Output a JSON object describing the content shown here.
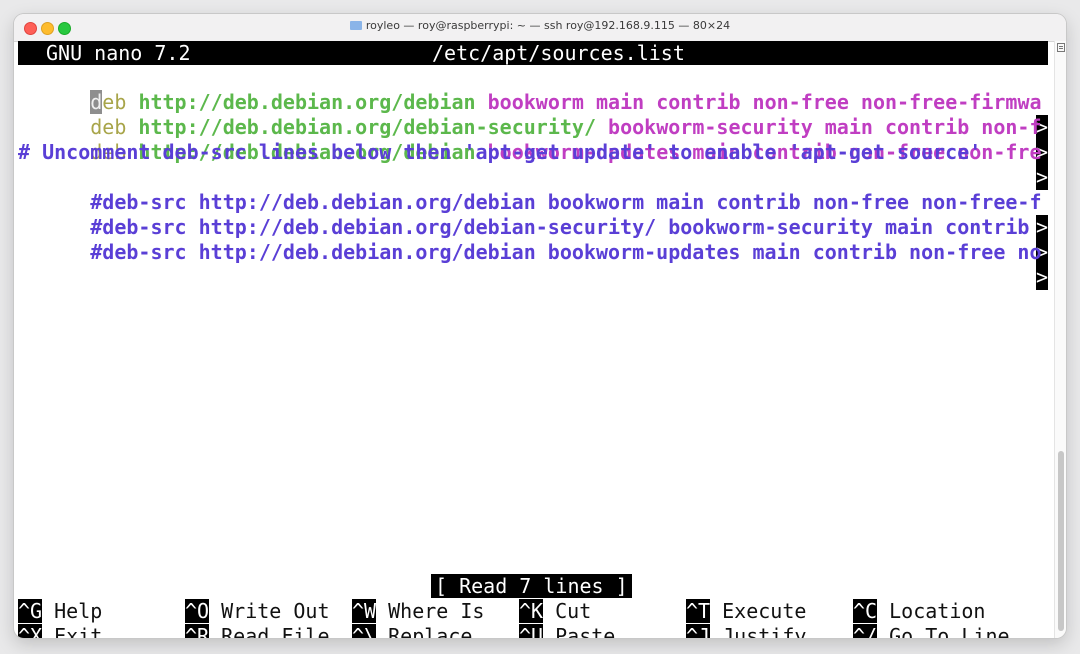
{
  "window": {
    "title": "royleo — roy@raspberrypi: ~ — ssh roy@192.168.9.115 — 80×24"
  },
  "nano": {
    "version": "GNU nano 7.2",
    "filename": "/etc/apt/sources.list",
    "status": "[ Read 7 lines ]"
  },
  "lines": [
    {
      "cursor": "d",
      "kw": "eb",
      "url": "http://deb.debian.org/debian",
      "comps": "bookworm main contrib non-free non-free-firmwa",
      "more": ">"
    },
    {
      "kw": "deb",
      "url": "http://deb.debian.org/debian-security/",
      "comps": "bookworm-security main contrib non-f",
      "more": ">"
    },
    {
      "kw": "deb",
      "url": "http://deb.debian.org/debian",
      "comps": "bookworm-updates main contrib non-free non-fre",
      "more": ">"
    },
    {
      "comment": "# Uncomment deb-src lines below then 'apt-get update' to enable 'apt-get source'"
    },
    {
      "comment": "#deb-src http://deb.debian.org/debian bookworm main contrib non-free non-free-f",
      "more": ">"
    },
    {
      "comment": "#deb-src http://deb.debian.org/debian-security/ bookworm-security main contrib ",
      "more": ">"
    },
    {
      "comment": "#deb-src http://deb.debian.org/debian bookworm-updates main contrib non-free no",
      "more": ">"
    }
  ],
  "shortcuts": [
    {
      "key": "^G",
      "label": "Help"
    },
    {
      "key": "^O",
      "label": "Write Out"
    },
    {
      "key": "^W",
      "label": "Where Is"
    },
    {
      "key": "^K",
      "label": "Cut"
    },
    {
      "key": "^T",
      "label": "Execute"
    },
    {
      "key": "^C",
      "label": "Location"
    },
    {
      "key": "^X",
      "label": "Exit"
    },
    {
      "key": "^R",
      "label": "Read File"
    },
    {
      "key": "^\\",
      "label": "Replace"
    },
    {
      "key": "^U",
      "label": "Paste"
    },
    {
      "key": "^J",
      "label": "Justify"
    },
    {
      "key": "^/",
      "label": "Go To Line"
    }
  ],
  "icons": [
    "close-icon",
    "minimize-icon",
    "zoom-icon",
    "folder-icon",
    "scroll-top-icon"
  ]
}
